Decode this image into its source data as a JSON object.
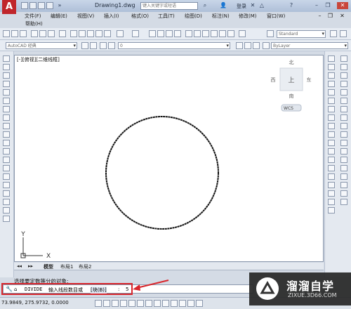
{
  "title_bar": {
    "document_title": "Drawing1.dwg",
    "search_placeholder": "键入关键字或短语",
    "login_label": "登录",
    "help_label": "?"
  },
  "menu": {
    "items": [
      "文件(F)",
      "编辑(E)",
      "视图(V)",
      "插入(I)",
      "格式(O)",
      "工具(T)",
      "绘图(D)",
      "标注(N)",
      "修改(M)",
      "窗口(W)"
    ],
    "help": "帮助(H)"
  },
  "toolbar1": {
    "style_combo": "Standard"
  },
  "toolbar2": {
    "workspace": "AutoCAD 经典",
    "linetype": "ByLayer",
    "layer": "0"
  },
  "canvas": {
    "viewport_label": "[-][俯视][二维线框]",
    "compass": {
      "north": "北",
      "south": "南",
      "west": "西",
      "east": "东",
      "center": "上"
    },
    "wcs_label": "WCS",
    "ucs_y": "Y",
    "ucs_x": "X"
  },
  "layout_tabs": [
    "模型",
    "布局1",
    "布局2"
  ],
  "command": {
    "history": "选择要定数等分的对象:",
    "prompt_prefix": "DIVIDE",
    "prompt_text": "输入线段数目或",
    "option": "[块(B)]",
    "value": "5"
  },
  "status": {
    "coords": "73.9849,  275.9732, 0.0000"
  },
  "watermark": {
    "title": "溜溜自学",
    "url": "ZIXUE.3D66.COM"
  },
  "colors": {
    "accent_red": "#d9262c",
    "titlebar": "#b8c8df",
    "canvas_bg": "#ffffff"
  }
}
